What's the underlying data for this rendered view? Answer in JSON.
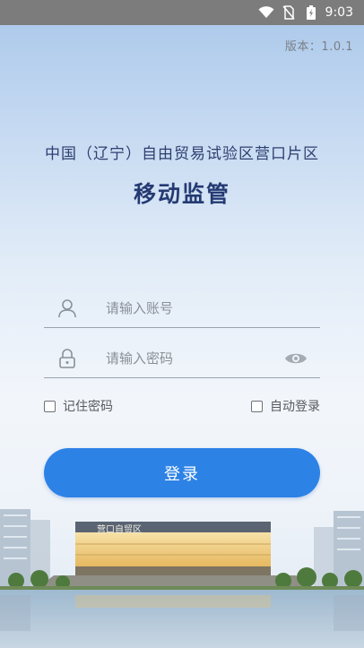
{
  "status_bar": {
    "time": "9:03",
    "icons": [
      "wifi-icon",
      "no-sim-icon",
      "battery-charging-icon"
    ]
  },
  "header": {
    "version": "版本：1.0.1",
    "subtitle": "中国（辽宁）自由贸易试验区营口片区",
    "title": "移动监管"
  },
  "form": {
    "username_placeholder": "请输入账号",
    "password_placeholder": "请输入密码",
    "remember_label": "记住密码",
    "auto_login_label": "自动登录",
    "login_label": "登录"
  },
  "background": {
    "building_sign": "营口自贸区"
  },
  "colors": {
    "accent": "#2d82e6",
    "title": "#253a73",
    "status_bar": "#7c7c7c"
  }
}
